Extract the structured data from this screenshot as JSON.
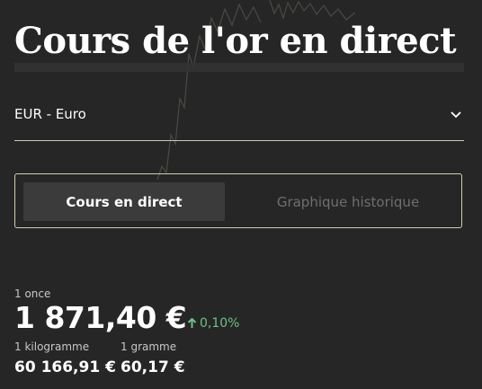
{
  "page": {
    "title": "Cours de l'or en direct"
  },
  "currency_select": {
    "selected": "EUR - Euro",
    "icon": "chevron-down-icon"
  },
  "tabs": [
    {
      "label": "Cours en direct",
      "active": true
    },
    {
      "label": "Graphique historique",
      "active": false
    }
  ],
  "prices": {
    "ounce": {
      "unit": "1 once",
      "value": "1 871,40 €"
    },
    "change": {
      "value": "0,10%",
      "direction": "up",
      "icon": "arrow-up-icon",
      "color": "#6fc08a"
    },
    "kilogram": {
      "unit": "1 kilogramme",
      "value": "60 166,91 €"
    },
    "gram": {
      "unit": "1 gramme",
      "value": "60,17 €"
    }
  },
  "colors": {
    "background": "#262626",
    "accent_border": "#d6cfa8",
    "active_tab_bg": "#3b3b3b",
    "inactive_tab_text": "#6f6f6f"
  }
}
